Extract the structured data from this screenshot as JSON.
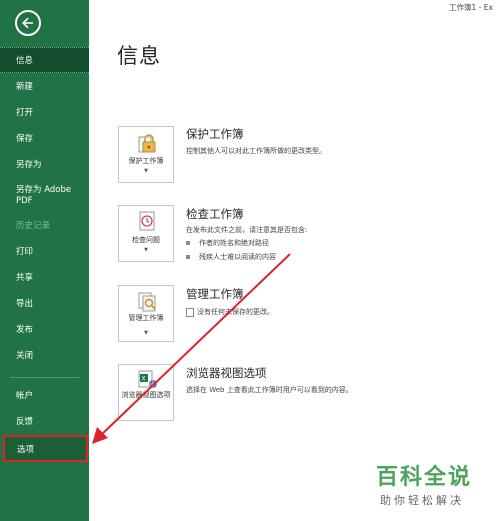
{
  "titlebar": {
    "text": "工作簿1 - Ex"
  },
  "sidebar": {
    "back_icon": "back-arrow-icon",
    "items": [
      {
        "label": "信息",
        "state": "selected"
      },
      {
        "label": "新建"
      },
      {
        "label": "打开"
      },
      {
        "label": "保存"
      },
      {
        "label": "另存为"
      },
      {
        "label": "另存为 Adobe PDF"
      },
      {
        "label": "历史记录",
        "state": "disabled"
      },
      {
        "label": "打印"
      },
      {
        "label": "共享"
      },
      {
        "label": "导出"
      },
      {
        "label": "发布"
      },
      {
        "label": "关闭"
      },
      {
        "label": "帐户"
      },
      {
        "label": "反馈"
      },
      {
        "label": "选项",
        "state": "highlighted"
      }
    ]
  },
  "main": {
    "title": "信息",
    "sections": [
      {
        "tile_label": "保护工作簿",
        "tile_icon": "lock-icon",
        "has_dropdown": true,
        "title": "保护工作簿",
        "description": "控制其他人可以对此工作簿所做的更改类型。"
      },
      {
        "tile_label": "检查问题",
        "tile_icon": "check-icon",
        "has_dropdown": true,
        "title": "检查工作簿",
        "description": "在发布此文件之前，请注意其是否包含:",
        "bullets": [
          "作者的姓名和绝对路径",
          "残疾人士难以阅读的内容"
        ]
      },
      {
        "tile_label": "管理工作簿",
        "tile_icon": "manage-workbook-icon",
        "has_dropdown": true,
        "title": "管理工作簿",
        "description": "没有任何未保存的更改。"
      },
      {
        "tile_label": "浏览器视图选项",
        "tile_icon": "browser-view-icon",
        "title": "浏览器视图选项",
        "description": "选择在 Web 上查看此工作簿时用户可以看到的内容。"
      }
    ]
  },
  "watermark": {
    "title": "百科全说",
    "subtitle": "助你轻松解决"
  },
  "colors": {
    "sidebar": "#217346",
    "selected": "#124d2d",
    "annotation": "#d9242a"
  }
}
